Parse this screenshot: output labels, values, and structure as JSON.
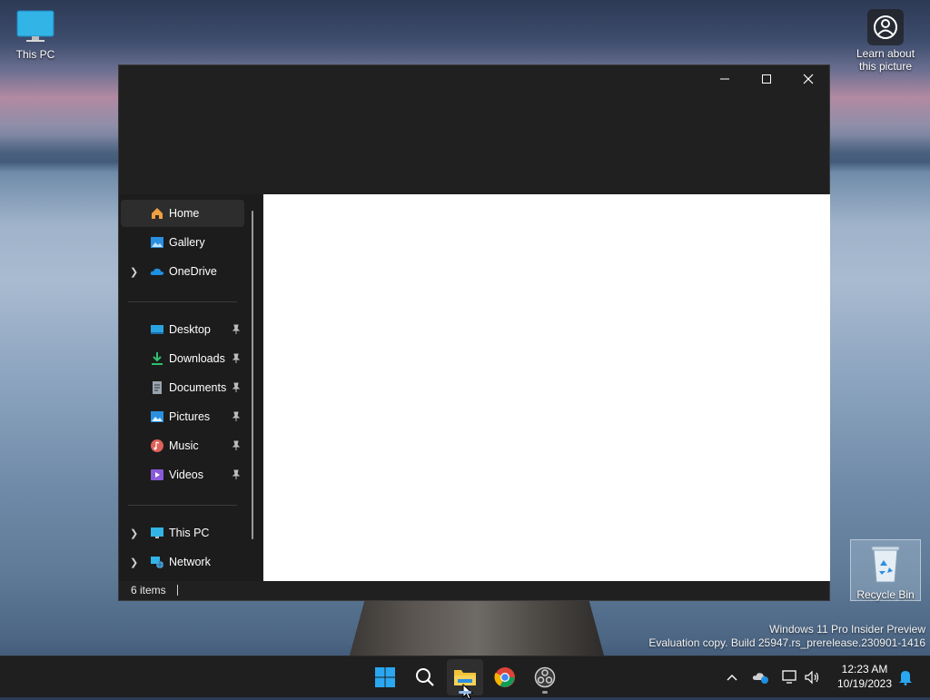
{
  "desktop": {
    "icons": {
      "this_pc": "This PC",
      "learn": "Learn about this picture",
      "recycle_bin": "Recycle Bin"
    }
  },
  "explorer": {
    "nav": {
      "items": [
        {
          "label": "Home"
        },
        {
          "label": "Gallery"
        },
        {
          "label": "OneDrive"
        },
        {
          "label": "Desktop"
        },
        {
          "label": "Downloads"
        },
        {
          "label": "Documents"
        },
        {
          "label": "Pictures"
        },
        {
          "label": "Music"
        },
        {
          "label": "Videos"
        },
        {
          "label": "This PC"
        },
        {
          "label": "Network"
        }
      ]
    },
    "status": {
      "items_count": "6 items"
    }
  },
  "watermark": {
    "line1": "Windows 11 Pro Insider Preview",
    "line2": "Evaluation copy. Build 25947.rs_prerelease.230901-1416"
  },
  "taskbar": {
    "clock": {
      "time": "12:23 AM",
      "date": "10/19/2023"
    }
  },
  "colors": {
    "folder_yellow": "#f2c33a",
    "accent_blue": "#1e90e0",
    "window_bg": "#202020"
  }
}
